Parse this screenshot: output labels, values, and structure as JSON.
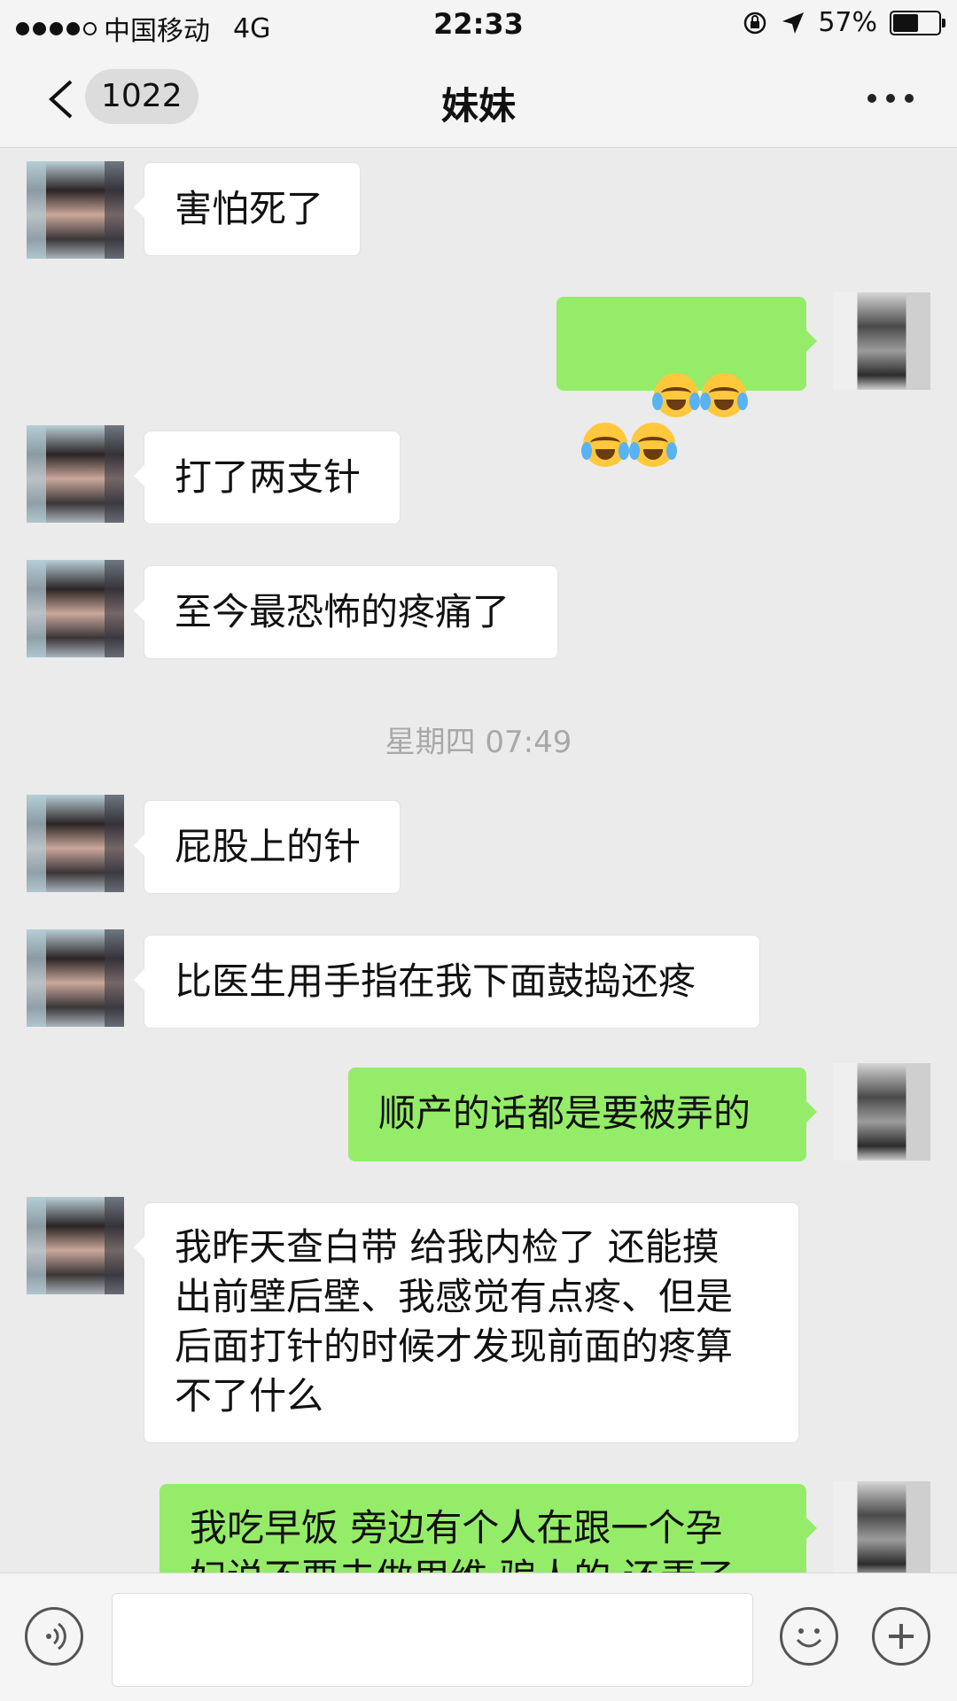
{
  "status_bar": {
    "carrier": "中国移动",
    "network": "4G",
    "time": "22:33",
    "battery_percent": "57%",
    "battery_level": 0.57
  },
  "nav": {
    "unread_count": "1022",
    "title": "妹妹"
  },
  "messages": [
    {
      "side": "in",
      "text": "害怕死了"
    },
    {
      "side": "out",
      "emoji": [
        "loudly-crying-face",
        "loudly-crying-face",
        "loudly-crying-face",
        "loudly-crying-face"
      ]
    },
    {
      "side": "in",
      "text": "打了两支针"
    },
    {
      "side": "in",
      "text": "至今最恐怖的疼痛了"
    },
    {
      "timestamp": "星期四 07:49"
    },
    {
      "side": "in",
      "text": "屁股上的针"
    },
    {
      "side": "in",
      "text": "比医生用手指在我下面鼓捣还疼"
    },
    {
      "side": "out",
      "text": "顺产的话都是要被弄的"
    },
    {
      "side": "in",
      "text": "我昨天查白带 给我内检了 还能摸\n出前壁后壁、我感觉有点疼、但是\n后面打针的时候才发现前面的疼算\n不了什么"
    },
    {
      "side": "out",
      "text": "我吃早饭 旁边有个人在跟一个孕\n妇说不要去做甩维 骗人的 还弄了"
    }
  ],
  "colors": {
    "outgoing_bubble": "#95ec69",
    "incoming_bubble": "#ffffff",
    "chat_background": "#ebebeb"
  }
}
